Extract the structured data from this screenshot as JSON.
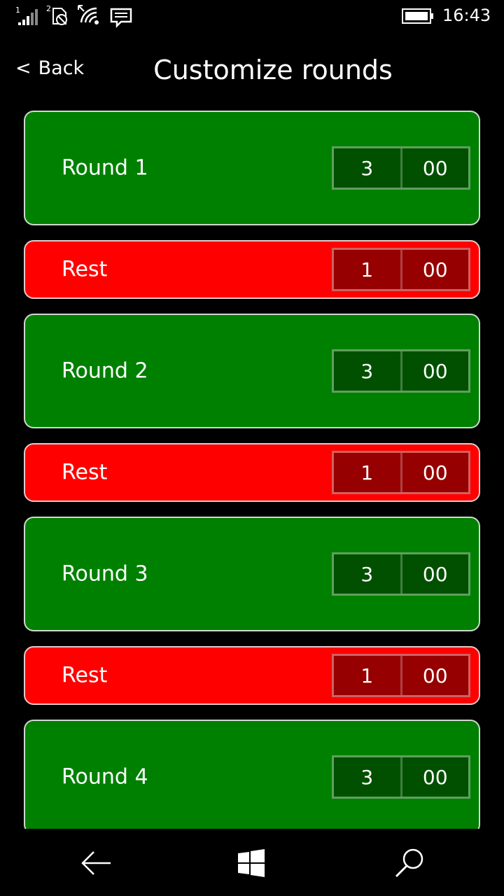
{
  "status_bar": {
    "time": "16:43",
    "signal_sup": "1",
    "sim2_sup": "2",
    "icons": [
      "signal-icon",
      "sim2-no-sim-icon",
      "wifi-icon",
      "message-icon",
      "battery-icon"
    ]
  },
  "header": {
    "back_chevron": "<",
    "back_label": "Back",
    "title": "Customize rounds"
  },
  "rows": [
    {
      "type": "round",
      "label": "Round 1",
      "minutes": "3",
      "seconds": "00"
    },
    {
      "type": "rest",
      "label": "Rest",
      "minutes": "1",
      "seconds": "00"
    },
    {
      "type": "round",
      "label": "Round 2",
      "minutes": "3",
      "seconds": "00"
    },
    {
      "type": "rest",
      "label": "Rest",
      "minutes": "1",
      "seconds": "00"
    },
    {
      "type": "round",
      "label": "Round 3",
      "minutes": "3",
      "seconds": "00"
    },
    {
      "type": "rest",
      "label": "Rest",
      "minutes": "1",
      "seconds": "00"
    },
    {
      "type": "round",
      "label": "Round 4",
      "minutes": "3",
      "seconds": "00"
    }
  ],
  "colors": {
    "round_bg": "#008000",
    "rest_bg": "#ff0000",
    "round_time_bg": "#005000",
    "rest_time_bg": "#960000"
  },
  "navbar": {
    "icons": [
      "back-arrow-icon",
      "windows-icon",
      "search-icon"
    ]
  }
}
